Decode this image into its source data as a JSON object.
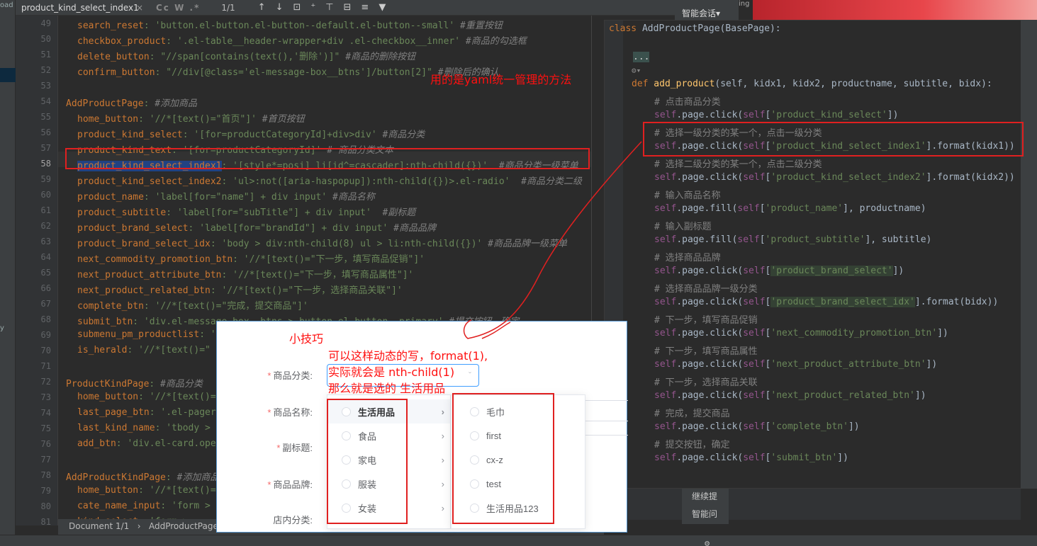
{
  "left_strip": {
    "top_text": "oad",
    "bottom_text": "y"
  },
  "search": {
    "query": "product_kind_select_index1",
    "close_icon": "×",
    "toolbar_glyphs": "Cc W .*",
    "match_count": "1/1",
    "tool_icons": "↑↓⊡⁺⊤⊟≡▼"
  },
  "right_top": {
    "ai_tab": "智能会话▾",
    "peek": "ing"
  },
  "line_numbers": [
    "49",
    "50",
    "51",
    "52",
    "53",
    "54",
    "55",
    "56",
    "57",
    "58",
    "59",
    "60",
    "61",
    "62",
    "63",
    "64",
    "65",
    "66",
    "67",
    "68",
    "69",
    "70",
    "71",
    "72",
    "73",
    "74",
    "75",
    "76",
    "77",
    "78",
    "79",
    "80",
    "81"
  ],
  "current_line": "58",
  "left_code": [
    {
      "ind": true,
      "key": "search_reset",
      "val": ": 'button.el-button.el-button--default.el-button--small'",
      "cmt": " #重置按钮"
    },
    {
      "ind": true,
      "key": "checkbox_product",
      "val": ": '.el-table__header-wrapper+div .el-checkbox__inner'",
      "cmt": " #商品的勾选框"
    },
    {
      "ind": true,
      "key": "delete_button",
      "val": ": \"//span[contains(text(),'删除')]\"",
      "cmt": " #商品的删除按钮"
    },
    {
      "ind": true,
      "key": "confirm_button",
      "val": ": \"//div[@class='el-message-box__btns']/button[2]\"",
      "cmt": " #删除后的确认"
    },
    {
      "ind": false,
      "key": "",
      "val": "",
      "cmt": ""
    },
    {
      "ind": false,
      "key": "AddProductPage",
      "val": ":",
      "cmt": " #添加商品"
    },
    {
      "ind": true,
      "key": "home_button",
      "val": ": '//*[text()=\"首页\"]'",
      "cmt": " #首页按钮"
    },
    {
      "ind": true,
      "key": "product_kind_select",
      "val": ": '[for=productCategoryId]+div>div'",
      "cmt": " #商品分类"
    },
    {
      "ind": true,
      "key": "product_kind_text",
      "val": ": '[for=productCategoryId]'",
      "cmt": " # 商品分类文本"
    },
    {
      "ind": true,
      "key": "product_kind_select_index1",
      "val": ": '[style*=posi] li[id^=cascader]:nth-child({})'",
      "cmt": "  #商品分类一级菜单"
    },
    {
      "ind": true,
      "key": "product_kind_select_index2",
      "val": ": 'ul>:not([aria-haspopup]):nth-child({})>.el-radio'",
      "cmt": "  #商品分类二级"
    },
    {
      "ind": true,
      "key": "product_name",
      "val": ": 'label[for=\"name\"] + div input'",
      "cmt": " #商品名称"
    },
    {
      "ind": true,
      "key": "product_subtitle",
      "val": ": 'label[for=\"subTitle\"] + div input'",
      "cmt": "  #副标题"
    },
    {
      "ind": true,
      "key": "product_brand_select",
      "val": ": 'label[for=\"brandId\"] + div input'",
      "cmt": " #商品品牌"
    },
    {
      "ind": true,
      "key": "product_brand_select_idx",
      "val": ": 'body > div:nth-child(8) ul > li:nth-child({})'",
      "cmt": " #商品品牌一级菜单"
    },
    {
      "ind": true,
      "key": "next_commodity_promotion_btn",
      "val": ": '//*[text()=\"下一步，填写商品促销\"]'",
      "cmt": ""
    },
    {
      "ind": true,
      "key": "next_product_attribute_btn",
      "val": ": '//*[text()=\"下一步，填写商品属性\"]'",
      "cmt": ""
    },
    {
      "ind": true,
      "key": "next_product_related_btn",
      "val": ": '//*[text()=\"下一步，选择商品关联\"]'",
      "cmt": ""
    },
    {
      "ind": true,
      "key": "complete_btn",
      "val": ": '//*[text()=\"完成，提交商品\"]'",
      "cmt": ""
    },
    {
      "ind": true,
      "key": "submit_btn",
      "val": ": 'div.el-message-box__btns > button.el-button--primary'",
      "cmt": " #提交按钮，确定"
    },
    {
      "ind": true,
      "key": "submenu_pm_productlist",
      "val": ": '",
      "cmt": ""
    },
    {
      "ind": true,
      "key": "is_herald",
      "val": ": '//*[text()=\"",
      "cmt": ""
    },
    {
      "ind": false,
      "key": "",
      "val": "",
      "cmt": ""
    },
    {
      "ind": false,
      "key": "ProductKindPage",
      "val": ":",
      "cmt": " #商品分类"
    },
    {
      "ind": true,
      "key": "home_button",
      "val": ": '//*[text()=",
      "cmt": ""
    },
    {
      "ind": true,
      "key": "last_page_btn",
      "val": ": '.el-pager",
      "cmt": ""
    },
    {
      "ind": true,
      "key": "last_kind_name",
      "val": ": 'tbody >",
      "cmt": ""
    },
    {
      "ind": true,
      "key": "add_btn",
      "val": ": 'div.el-card.ope",
      "cmt": ""
    },
    {
      "ind": false,
      "key": "",
      "val": "",
      "cmt": ""
    },
    {
      "ind": false,
      "key": "AddProductKindPage",
      "val": ":",
      "cmt": " #添加商品"
    },
    {
      "ind": true,
      "key": "home_button",
      "val": ": '//*[text()=",
      "cmt": ""
    },
    {
      "ind": true,
      "key": "cate_name_input",
      "val": ": 'form >",
      "cmt": ""
    },
    {
      "ind": true,
      "key": "kind_select",
      "val": ": 'form > ...",
      "cmt": ""
    }
  ],
  "status_bar": {
    "doc": "Document 1/1",
    "crumb": "AddProductPage:"
  },
  "right_code": {
    "class_line": {
      "kw": "class",
      "name": " AddProductPage(BasePage):"
    },
    "fold": "...",
    "fold_icon": "⚙▾",
    "def_line": {
      "kw": "def",
      "fn": " add_product",
      "params": "(self, kidx1, kidx2, productname, subtitle, bidx):"
    },
    "lines": [
      {
        "type": "cmt",
        "text": "# 点击商品分类"
      },
      {
        "type": "code",
        "pre": "self.page.click(self[",
        "arg": "'product_kind_select'",
        "post": "])",
        "hl": false
      },
      {
        "type": "cmt",
        "text": "# 选择一级分类的某一个，点击一级分类"
      },
      {
        "type": "code",
        "pre": "self.page.click(self[",
        "arg": "'product_kind_select_index1'",
        "post": "].format(kidx1))",
        "hl": false
      },
      {
        "type": "cmt",
        "text": "# 选择二级分类的某一个，点击二级分类"
      },
      {
        "type": "code",
        "pre": "self.page.click(self[",
        "arg": "'product_kind_select_index2'",
        "post": "].format(kidx2))",
        "hl": false
      },
      {
        "type": "cmt",
        "text": "# 输入商品名称"
      },
      {
        "type": "code",
        "pre": "self.page.fill(self[",
        "arg": "'product_name'",
        "post": "], productname)",
        "hl": false
      },
      {
        "type": "cmt",
        "text": "# 输入副标题"
      },
      {
        "type": "code",
        "pre": "self.page.fill(self[",
        "arg": "'product_subtitle'",
        "post": "], subtitle)",
        "hl": false
      },
      {
        "type": "cmt",
        "text": "# 选择商品品牌"
      },
      {
        "type": "code",
        "pre": "self.page.click(self[",
        "arg": "'product_brand_select'",
        "post": "])",
        "hl": true
      },
      {
        "type": "cmt",
        "text": "# 选择商品品牌一级分类"
      },
      {
        "type": "code",
        "pre": "self.page.click(self[",
        "arg": "'product_brand_select_idx'",
        "post": "].format(bidx))",
        "hl": true
      },
      {
        "type": "cmt",
        "text": "# 下一步，填写商品促销"
      },
      {
        "type": "code",
        "pre": "self.page.click(self[",
        "arg": "'next_commodity_promotion_btn'",
        "post": "])",
        "hl": false
      },
      {
        "type": "cmt",
        "text": "# 下一步，填写商品属性"
      },
      {
        "type": "code",
        "pre": "self.page.click(self[",
        "arg": "'next_product_attribute_btn'",
        "post": "])",
        "hl": false
      },
      {
        "type": "cmt",
        "text": "# 下一步，选择商品关联"
      },
      {
        "type": "code",
        "pre": "self.page.click(self[",
        "arg": "'next_product_related_btn'",
        "post": "])",
        "hl": false
      },
      {
        "type": "cmt",
        "text": "# 完成，提交商品"
      },
      {
        "type": "code",
        "pre": "self.page.click(self[",
        "arg": "'complete_btn'",
        "post": "])",
        "hl": false
      },
      {
        "type": "cmt",
        "text": "# 提交按钮，确定"
      },
      {
        "type": "code",
        "pre": "self.page.click(self[",
        "arg": "'submit_btn'",
        "post": "])",
        "hl": false
      }
    ]
  },
  "ai_side": {
    "continue": "继续提",
    "ask": "智能问"
  },
  "annotations": {
    "yaml_note": "用的是yaml统一管理的方法",
    "tip_title": "小技巧",
    "tip_line1": "可以这样动态的写，format(1),",
    "tip_line2": "实际就会是 nth-child(1)",
    "tip_line3": "那么就是选的 生活用品"
  },
  "popup": {
    "labels": [
      "商品分类:",
      "商品名称:",
      "副标题:",
      "商品品牌:",
      "店内分类:"
    ],
    "required": [
      true,
      true,
      true,
      true,
      false
    ],
    "menu1": [
      "生活用品",
      "食品",
      "家电",
      "服装",
      "女装"
    ],
    "menu2": [
      "毛巾",
      "first",
      "cx-z",
      "test",
      "生活用品123"
    ],
    "chevron": "›",
    "arrow": "ˇ"
  }
}
